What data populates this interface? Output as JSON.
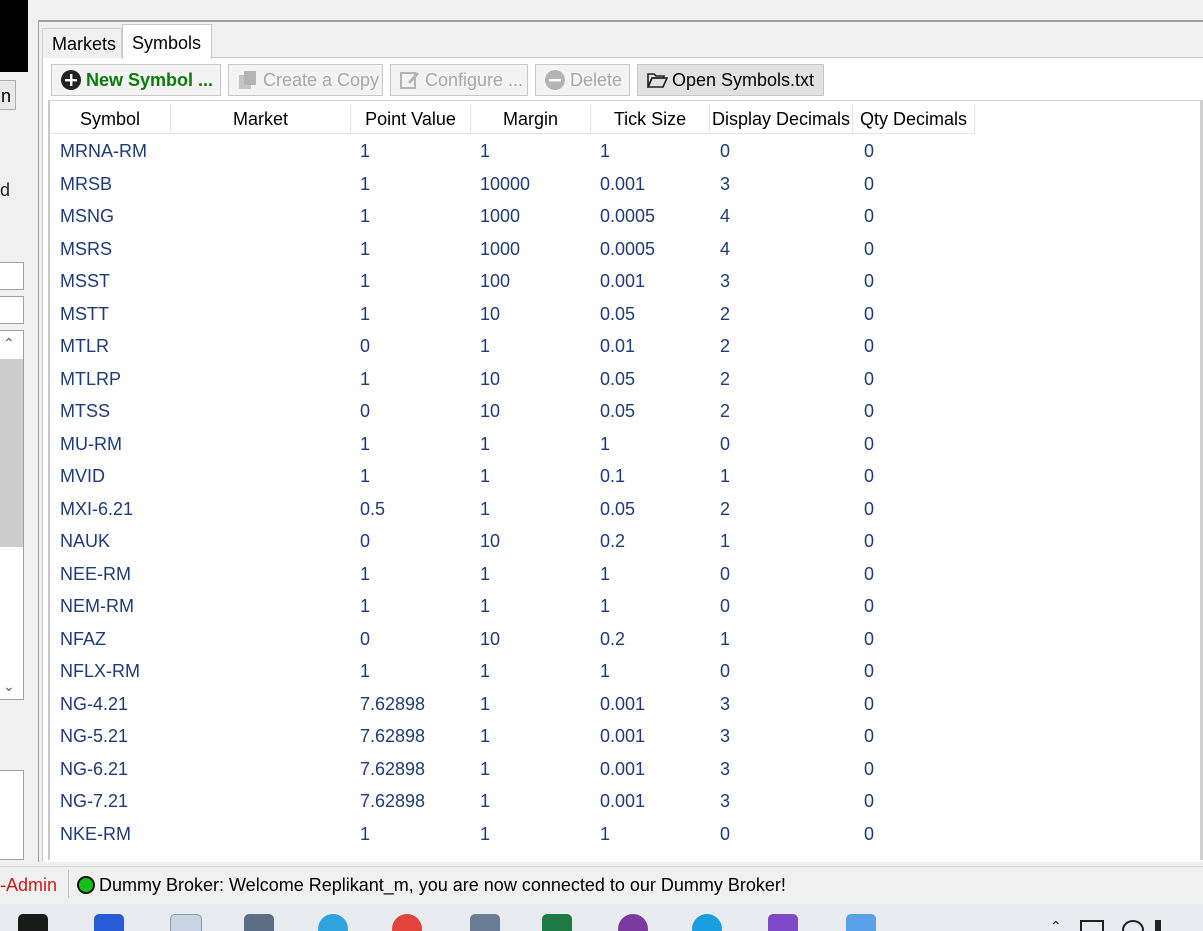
{
  "left_panel": {
    "button_fragment": "n",
    "text_fragment": "d"
  },
  "tabs": [
    {
      "label": "Markets",
      "active": false
    },
    {
      "label": "Symbols",
      "active": true
    }
  ],
  "toolbar": {
    "new_symbol": "New Symbol ...",
    "create_copy": "Create a Copy",
    "configure": "Configure ...",
    "delete": "Delete",
    "open_symbols": "Open Symbols.txt"
  },
  "table": {
    "columns": [
      "Symbol",
      "Market",
      "Point Value",
      "Margin",
      "Tick Size",
      "Display Decimals",
      "Qty Decimals"
    ],
    "rows": [
      [
        "MRNA-RM",
        "",
        "1",
        "1",
        "1",
        "0",
        "0"
      ],
      [
        "MRSB",
        "",
        "1",
        "10000",
        "0.001",
        "3",
        "0"
      ],
      [
        "MSNG",
        "",
        "1",
        "1000",
        "0.0005",
        "4",
        "0"
      ],
      [
        "MSRS",
        "",
        "1",
        "1000",
        "0.0005",
        "4",
        "0"
      ],
      [
        "MSST",
        "",
        "1",
        "100",
        "0.001",
        "3",
        "0"
      ],
      [
        "MSTT",
        "",
        "1",
        "10",
        "0.05",
        "2",
        "0"
      ],
      [
        "MTLR",
        "",
        "0",
        "1",
        "0.01",
        "2",
        "0"
      ],
      [
        "MTLRP",
        "",
        "1",
        "10",
        "0.05",
        "2",
        "0"
      ],
      [
        "MTSS",
        "",
        "0",
        "10",
        "0.05",
        "2",
        "0"
      ],
      [
        "MU-RM",
        "",
        "1",
        "1",
        "1",
        "0",
        "0"
      ],
      [
        "MVID",
        "",
        "1",
        "1",
        "0.1",
        "1",
        "0"
      ],
      [
        "MXI-6.21",
        "",
        "0.5",
        "1",
        "0.05",
        "2",
        "0"
      ],
      [
        "NAUK",
        "",
        "0",
        "10",
        "0.2",
        "1",
        "0"
      ],
      [
        "NEE-RM",
        "",
        "1",
        "1",
        "1",
        "0",
        "0"
      ],
      [
        "NEM-RM",
        "",
        "1",
        "1",
        "1",
        "0",
        "0"
      ],
      [
        "NFAZ",
        "",
        "0",
        "10",
        "0.2",
        "1",
        "0"
      ],
      [
        "NFLX-RM",
        "",
        "1",
        "1",
        "1",
        "0",
        "0"
      ],
      [
        "NG-4.21",
        "",
        "7.62898",
        "1",
        "0.001",
        "3",
        "0"
      ],
      [
        "NG-5.21",
        "",
        "7.62898",
        "1",
        "0.001",
        "3",
        "0"
      ],
      [
        "NG-6.21",
        "",
        "7.62898",
        "1",
        "0.001",
        "3",
        "0"
      ],
      [
        "NG-7.21",
        "",
        "7.62898",
        "1",
        "0.001",
        "3",
        "0"
      ],
      [
        "NKE-RM",
        "",
        "1",
        "1",
        "1",
        "0",
        "0"
      ]
    ]
  },
  "status": {
    "admin_fragment": "-Admin",
    "connection_text": "Dummy Broker: Welcome Replikant_m, you are now connected to our Dummy Broker!",
    "connection_color": "#16c016"
  },
  "taskbar_icons": [
    "terminal-icon",
    "app-icon",
    "monitor-icon",
    "network-icon",
    "telegram-icon",
    "chrome-icon",
    "calculator-icon",
    "excel-icon",
    "github-icon",
    "app-circle-icon",
    "visual-studio-icon",
    "tool-icon"
  ],
  "colors": {
    "cell_text": "#1e3a78",
    "new_symbol": "#0a7a0a",
    "admin": "#d01818"
  }
}
